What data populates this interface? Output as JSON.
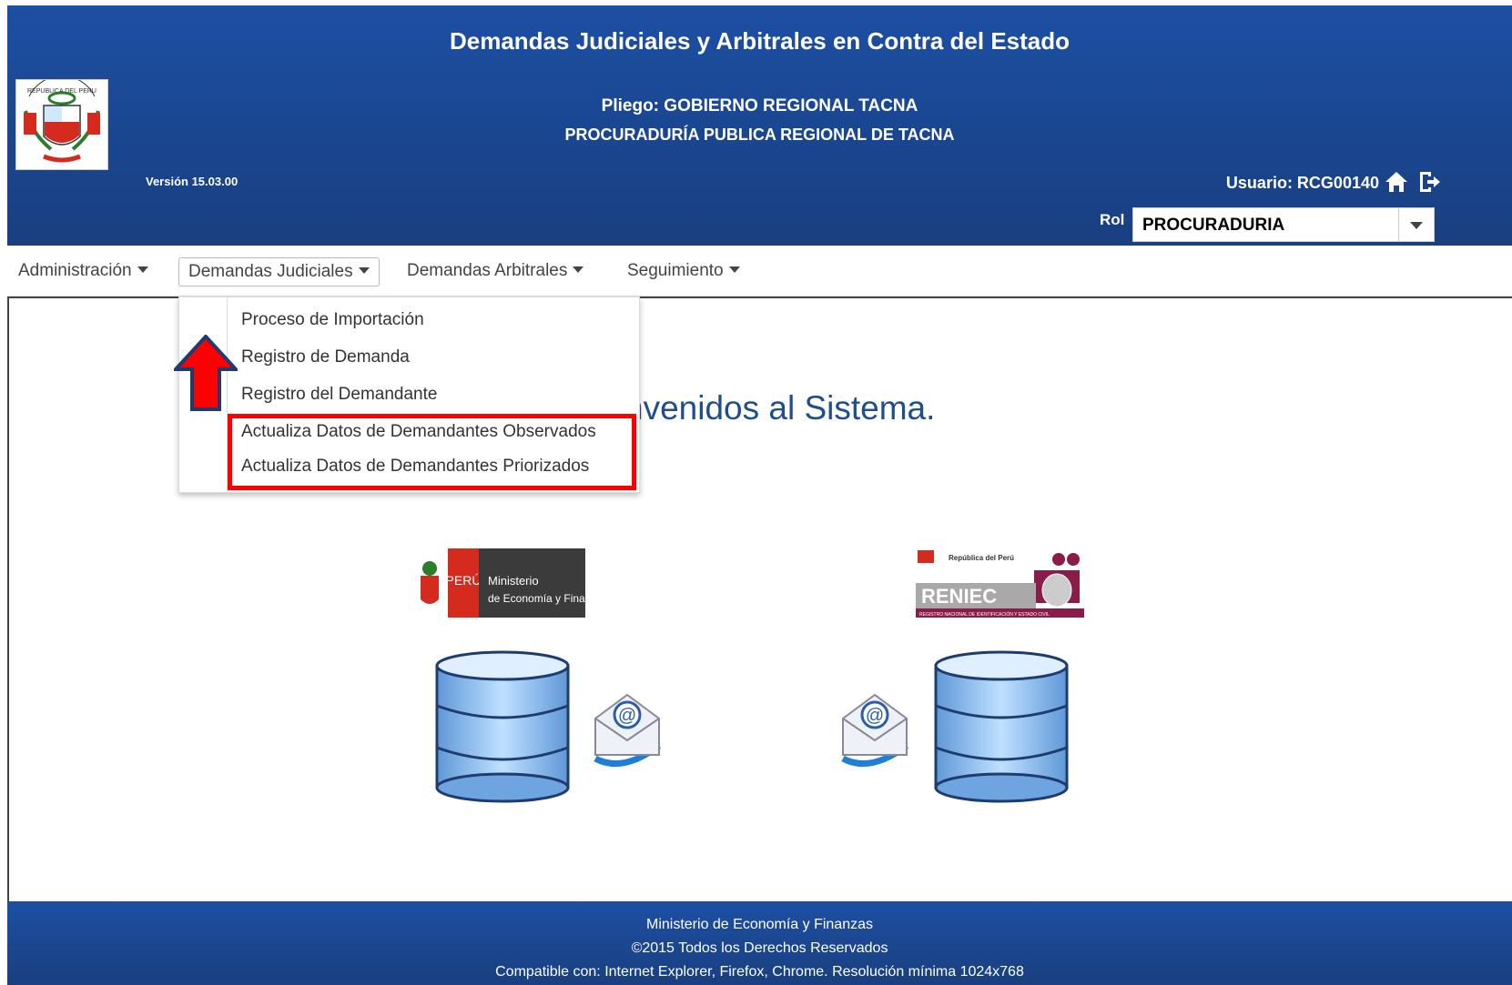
{
  "header": {
    "title": "Demandas Judiciales y Arbitrales en Contra del Estado",
    "pliego": "Pliego: GOBIERNO REGIONAL TACNA",
    "procuraduria": "PROCURADURÍA PUBLICA REGIONAL DE TACNA",
    "version": "Versión 15.03.00",
    "user_label": "Usuario: RCG00140",
    "rol_label": "Rol",
    "rol_value": "PROCURADURIA",
    "coat_text": "REPUBLICA DEL PERU"
  },
  "menu": {
    "items": [
      {
        "label": "Administración"
      },
      {
        "label": "Demandas Judiciales"
      },
      {
        "label": "Demandas Arbitrales"
      },
      {
        "label": "Seguimiento"
      }
    ]
  },
  "dropdown": {
    "items": [
      {
        "label": "Proceso de Importación"
      },
      {
        "label": "Registro de Demanda"
      },
      {
        "label": "Registro del Demandante"
      },
      {
        "label": "Actualiza Datos de Demandantes Observados"
      },
      {
        "label": "Actualiza Datos de Demandantes Priorizados"
      }
    ]
  },
  "main": {
    "welcome": "nvenidos al Sistema."
  },
  "logos": {
    "mef_line1": "PERÚ",
    "mef_line2": "Ministerio",
    "mef_line3": "de Economía y Finanzas",
    "reniec_top": "República del Perú",
    "reniec_name": "RENIEC",
    "reniec_sub": "REGISTRO NACIONAL DE IDENTIFICACIÓN Y ESTADO CIVIL"
  },
  "footer": {
    "line1": "Ministerio de Economía y Finanzas",
    "line2": "©2015 Todos los Derechos Reservados",
    "line3": "Compatible con: Internet Explorer, Firefox, Chrome. Resolución mínima 1024x768"
  },
  "colors": {
    "header_blue": "#1a4690",
    "highlight_red": "#ff0000",
    "welcome_blue": "#1f4e8c"
  }
}
